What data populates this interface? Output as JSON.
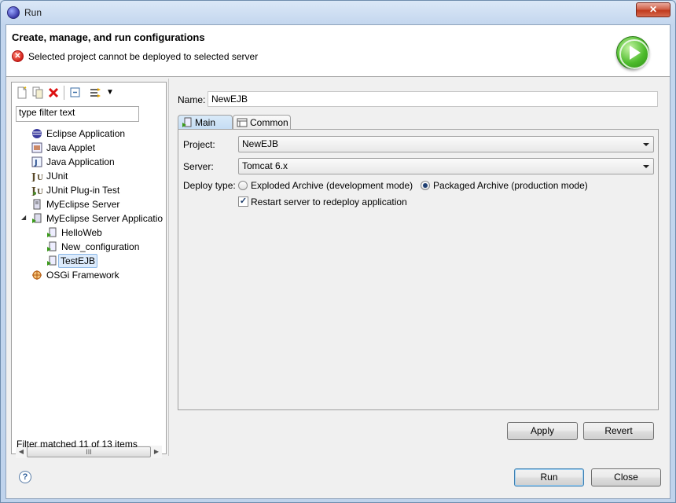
{
  "window": {
    "title": "Run",
    "close_label": "✕"
  },
  "header": {
    "title": "Create, manage, and run configurations",
    "message": "Selected project cannot be deployed to selected server",
    "error_glyph": "✕"
  },
  "toolbar": {
    "buttons": [
      {
        "name": "new-launch-configuration-icon",
        "glyph": "📄"
      },
      {
        "name": "duplicate-icon",
        "glyph": "📑"
      },
      {
        "name": "delete-icon",
        "glyph": "✖"
      },
      {
        "name": "collapse-all-icon",
        "glyph": "⊟"
      },
      {
        "name": "filter-icon",
        "glyph": "⇉"
      },
      {
        "name": "view-menu-icon",
        "glyph": "▾"
      }
    ]
  },
  "filter": {
    "placeholder": "type filter text",
    "value": "type filter text",
    "status": "Filter matched 11 of 13 items"
  },
  "tree": {
    "items": [
      {
        "label": "Eclipse Application",
        "icon": "eclipse-icon"
      },
      {
        "label": "Java Applet",
        "icon": "java-applet-icon"
      },
      {
        "label": "Java Application",
        "icon": "java-application-icon"
      },
      {
        "label": "JUnit",
        "icon": "junit-icon"
      },
      {
        "label": "JUnit Plug-in Test",
        "icon": "junit-plugin-icon"
      },
      {
        "label": "MyEclipse Server",
        "icon": "server-icon"
      },
      {
        "label": "MyEclipse Server Applicatio",
        "icon": "server-application-icon"
      },
      {
        "label": "HelloWeb",
        "icon": "server-config-icon"
      },
      {
        "label": "New_configuration",
        "icon": "server-config-icon"
      },
      {
        "label": "TestEJB",
        "icon": "server-config-icon"
      },
      {
        "label": "OSGi Framework",
        "icon": "osgi-icon"
      }
    ]
  },
  "scrollbar": {
    "left": "◀",
    "right": "▶",
    "grip": "III"
  },
  "config": {
    "name_label": "Name:",
    "name_value": "NewEJB",
    "tabs": [
      {
        "label": "Main"
      },
      {
        "label": "Common"
      }
    ],
    "project_label": "Project:",
    "project_value": "NewEJB",
    "server_label": "Server:",
    "server_value": "Tomcat  6.x",
    "deploy_label": "Deploy type:",
    "deploy_options": [
      {
        "label": "Exploded Archive (development mode)",
        "checked": false
      },
      {
        "label": "Packaged Archive (production mode)",
        "checked": true
      }
    ],
    "restart_label": "Restart server to redeploy application",
    "restart_checked": true,
    "check_glyph": "✓"
  },
  "buttons": {
    "apply": "Apply",
    "revert": "Revert",
    "run": "Run",
    "close": "Close",
    "help": "?"
  }
}
